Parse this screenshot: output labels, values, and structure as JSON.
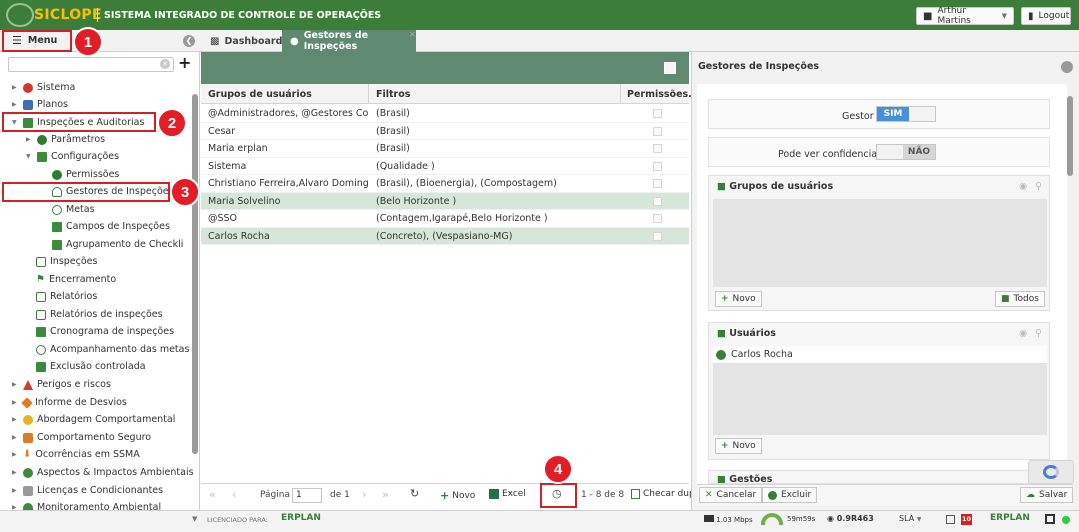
{
  "app": {
    "logo": "SICLOPE",
    "title": "SISTEMA INTEGRADO DE CONTROLE DE OPERAÇÕES",
    "user": "Arthur Martins",
    "logout": "Logout"
  },
  "tabs": {
    "menu": "Menu",
    "dashboard": "Dashboard",
    "gestores": "Gestores de Inspeções"
  },
  "sidebar": {
    "items": [
      {
        "label": "Sistema"
      },
      {
        "label": "Planos"
      },
      {
        "label": "Inspeções e Auditorias"
      },
      {
        "label": "Parâmetros"
      },
      {
        "label": "Configurações"
      },
      {
        "label": "Permissões"
      },
      {
        "label": "Gestores de Inspeções"
      },
      {
        "label": "Metas"
      },
      {
        "label": "Campos de Inspeções"
      },
      {
        "label": "Agrupamento de Checkli"
      },
      {
        "label": "Inspeções"
      },
      {
        "label": "Encerramento"
      },
      {
        "label": "Relatórios"
      },
      {
        "label": "Relatórios de inspeções"
      },
      {
        "label": "Cronograma de inspeções"
      },
      {
        "label": "Acompanhamento das metas"
      },
      {
        "label": "Exclusão controlada"
      },
      {
        "label": "Perigos e riscos"
      },
      {
        "label": "Informe de Desvios"
      },
      {
        "label": "Abordagem Comportamental"
      },
      {
        "label": "Comportamento Seguro"
      },
      {
        "label": "Ocorrências em SSMA"
      },
      {
        "label": "Aspectos & Impactos Ambientais"
      },
      {
        "label": "Licenças e Condicionantes"
      },
      {
        "label": "Monitoramento Ambiental"
      }
    ]
  },
  "callouts": [
    "1",
    "2",
    "3",
    "4"
  ],
  "grid": {
    "headers": [
      "Grupos de usuários",
      "Filtros",
      "Permissões..."
    ],
    "rows": [
      {
        "grupos": "@Administradores, @Gestores Corp...",
        "filtros": "(Brasil)"
      },
      {
        "grupos": "Cesar",
        "filtros": "(Brasil)"
      },
      {
        "grupos": "Maria erplan",
        "filtros": "(Brasil)"
      },
      {
        "grupos": "Sistema",
        "filtros": "(Qualidade )"
      },
      {
        "grupos": "Christiano Ferreira,Alvaro Domingu...",
        "filtros": "(Brasil), (Bioenergia), (Compostagem)"
      },
      {
        "grupos": "Maria Solvelino",
        "filtros": "(Belo Horizonte )"
      },
      {
        "grupos": "@SSO",
        "filtros": "(Contagem,Igarapé,Belo Horizonte )"
      },
      {
        "grupos": "Carlos Rocha",
        "filtros": "(Concreto), (Vespasiano-MG)"
      }
    ]
  },
  "pager": {
    "page_label": "Página",
    "page_value": "1",
    "of_label": "de 1",
    "novo": "Novo",
    "excel": "Excel",
    "range": "1 - 8 de 8",
    "checar": "Checar dup"
  },
  "right": {
    "title": "Gestores de Inspeções",
    "gestor_label": "Gestor",
    "gestor_value": "SIM",
    "confid_label": "Pode ver confidenciais",
    "confid_value": "NÃO",
    "grupos_title": "Grupos de usuários",
    "novo": "Novo",
    "todos": "Todos",
    "usuarios_title": "Usuários",
    "usuario_1": "Carlos Rocha",
    "gestoes_title": "Gestões",
    "cancelar": "Cancelar",
    "excluir": "Excluir",
    "salvar": "Salvar"
  },
  "status": {
    "licenciado": "LICENCIADO PARA:",
    "brand": "ERPLAN",
    "speed": "1.03 Mbps",
    "time": "59m59s",
    "version": "0.9R463",
    "sla": "SLA",
    "count": "10"
  },
  "colors": {
    "topbar": "#3c7d3a",
    "header": "#5f8a71",
    "accent": "#e21d25",
    "gold": "#f6c100"
  }
}
